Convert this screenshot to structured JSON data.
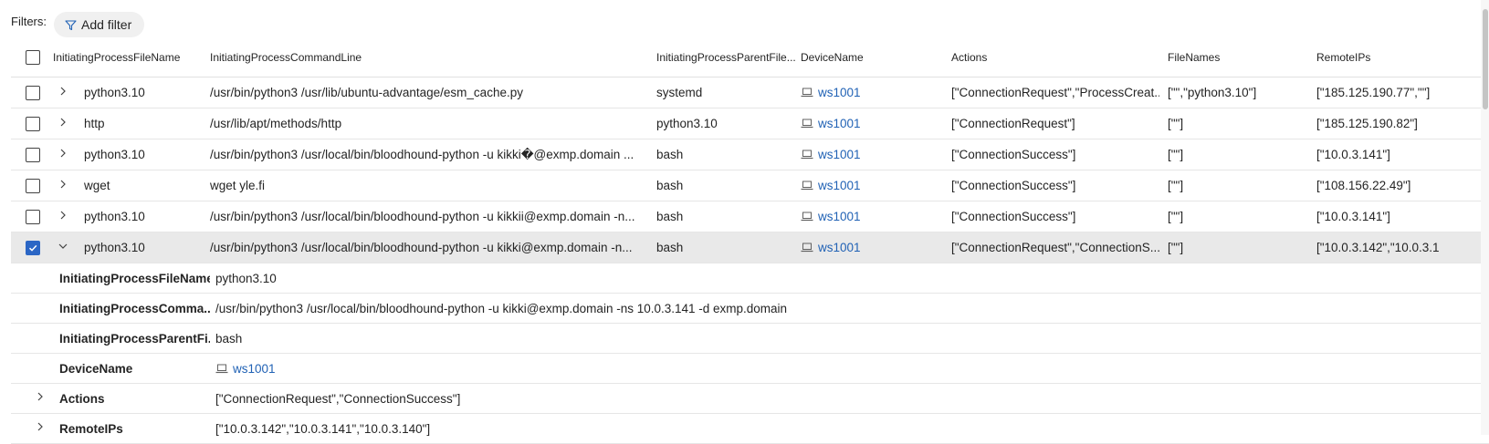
{
  "filters": {
    "label": "Filters:",
    "add_filter_label": "Add filter"
  },
  "columns": [
    "InitiatingProcessFileName",
    "InitiatingProcessCommandLine",
    "InitiatingProcessParentFile...",
    "DeviceName",
    "Actions",
    "FileNames",
    "RemoteIPs"
  ],
  "rows": [
    {
      "file": "python3.10",
      "cmd": "/usr/bin/python3 /usr/lib/ubuntu-advantage/esm_cache.py",
      "parent": "systemd",
      "device": "ws1001",
      "actions": "[\"ConnectionRequest\",\"ProcessCreat...",
      "files": "[\"\",\"python3.10\"]",
      "ips": "[\"185.125.190.77\",\"\"]"
    },
    {
      "file": "http",
      "cmd": "/usr/lib/apt/methods/http",
      "parent": "python3.10",
      "device": "ws1001",
      "actions": "[\"ConnectionRequest\"]",
      "files": "[\"\"]",
      "ips": "[\"185.125.190.82\"]"
    },
    {
      "file": "python3.10",
      "cmd": "/usr/bin/python3 /usr/local/bin/bloodhound-python -u kikki�@exmp.domain ...",
      "parent": "bash",
      "device": "ws1001",
      "actions": "[\"ConnectionSuccess\"]",
      "files": "[\"\"]",
      "ips": "[\"10.0.3.141\"]"
    },
    {
      "file": "wget",
      "cmd": "wget yle.fi",
      "parent": "bash",
      "device": "ws1001",
      "actions": "[\"ConnectionSuccess\"]",
      "files": "[\"\"]",
      "ips": "[\"108.156.22.49\"]"
    },
    {
      "file": "python3.10",
      "cmd": "/usr/bin/python3 /usr/local/bin/bloodhound-python -u kikkii@exmp.domain -n...",
      "parent": "bash",
      "device": "ws1001",
      "actions": "[\"ConnectionSuccess\"]",
      "files": "[\"\"]",
      "ips": "[\"10.0.3.141\"]"
    },
    {
      "file": "python3.10",
      "cmd": "/usr/bin/python3 /usr/local/bin/bloodhound-python -u kikki@exmp.domain -n...",
      "parent": "bash",
      "device": "ws1001",
      "actions": "[\"ConnectionRequest\",\"ConnectionS...",
      "files": "[\"\"]",
      "ips": "[\"10.0.3.142\",\"10.0.3.1"
    }
  ],
  "details": [
    {
      "label": "InitiatingProcessFileName",
      "value": "python3.10"
    },
    {
      "label": "InitiatingProcessComma...",
      "value": "/usr/bin/python3 /usr/local/bin/bloodhound-python -u kikki@exmp.domain -ns 10.0.3.141 -d exmp.domain"
    },
    {
      "label": "InitiatingProcessParentFi...",
      "value": "bash"
    },
    {
      "label": "DeviceName",
      "value": "ws1001"
    },
    {
      "label": "Actions",
      "value": "[\"ConnectionRequest\",\"ConnectionSuccess\"]"
    },
    {
      "label": "RemoteIPs",
      "value": "[\"10.0.3.142\",\"10.0.3.141\",\"10.0.3.140\"]"
    }
  ],
  "colors": {
    "accent": "#2b66c5",
    "link": "#2162b5",
    "selected_row": "#e9e9e9"
  }
}
